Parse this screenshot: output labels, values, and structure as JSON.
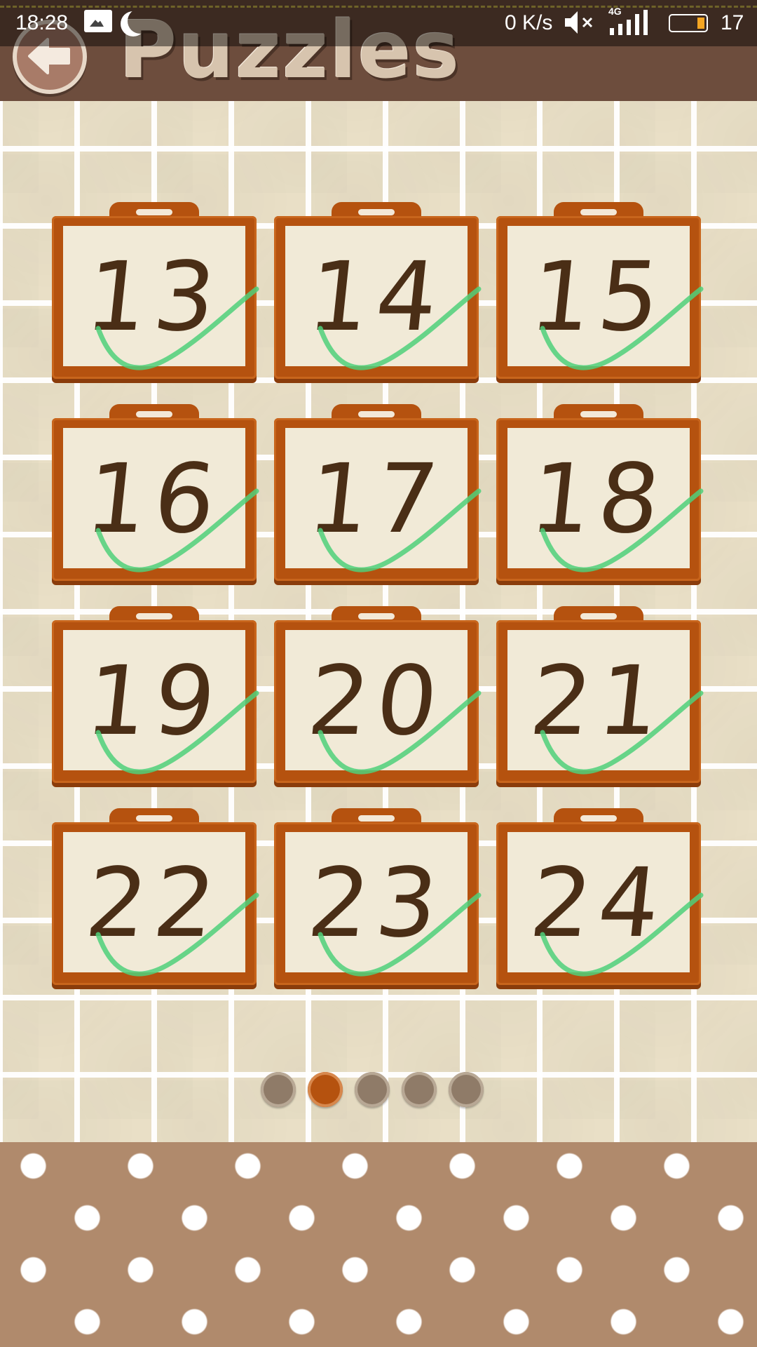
{
  "status_bar": {
    "time": "18:28",
    "speed": "0 K/s",
    "network": "4G",
    "battery": "17",
    "icons": [
      "photo-icon",
      "moon-icon",
      "mute-icon",
      "signal-icon",
      "battery-icon"
    ]
  },
  "header": {
    "title": "Puzzles",
    "back_icon": "back-arrow-icon"
  },
  "levels": [
    {
      "number": "13",
      "completed": true
    },
    {
      "number": "14",
      "completed": true
    },
    {
      "number": "15",
      "completed": true
    },
    {
      "number": "16",
      "completed": true
    },
    {
      "number": "17",
      "completed": true
    },
    {
      "number": "18",
      "completed": true
    },
    {
      "number": "19",
      "completed": true
    },
    {
      "number": "20",
      "completed": true
    },
    {
      "number": "21",
      "completed": true
    },
    {
      "number": "22",
      "completed": true
    },
    {
      "number": "23",
      "completed": true
    },
    {
      "number": "24",
      "completed": true
    }
  ],
  "pager": {
    "total_pages": 5,
    "current_page": 2
  },
  "colors": {
    "header_brown": "#6d4d3d",
    "card_orange": "#b5520f",
    "check_green": "#4fd07a",
    "number_brown": "#4a2e16",
    "footer_tan": "#b08a6c"
  }
}
